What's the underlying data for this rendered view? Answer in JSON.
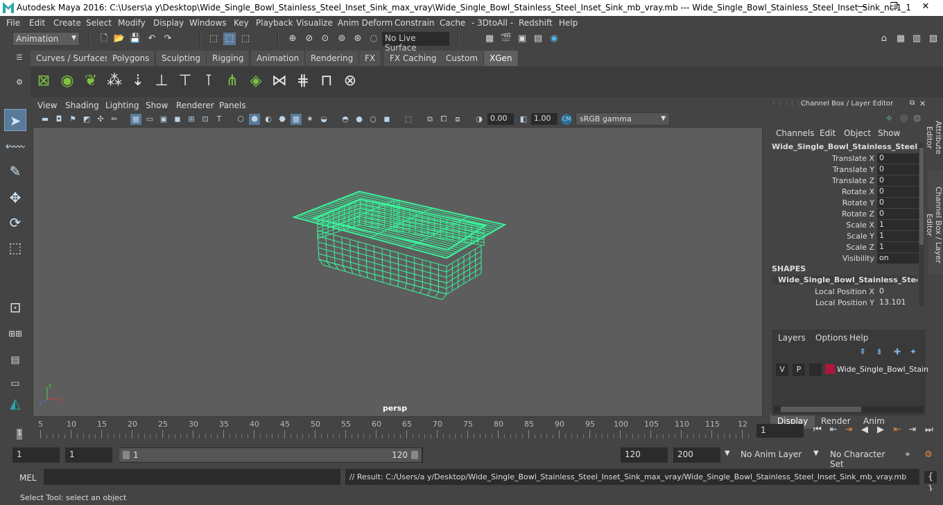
{
  "titlebar": {
    "title": "Autodesk Maya 2016: C:\\Users\\a y\\Desktop\\Wide_Single_Bowl_Stainless_Steel_Inset_Sink_max_vray\\Wide_Single_Bowl_Stainless_Steel_Inset_Sink_mb_vray.mb  ---  Wide_Single_Bowl_Stainless_Steel_Inset_Sink_ncl1_1",
    "minimize": "—",
    "maximize": "❐",
    "close": "✕"
  },
  "menubar": [
    "File",
    "Edit",
    "Create",
    "Select",
    "Modify",
    "Display",
    "Windows",
    "Key",
    "Playback",
    "Visualize",
    "Anim Deform",
    "Constrain",
    "Cache",
    "- 3DtoAll -",
    "Redshift",
    "Help"
  ],
  "statusline": {
    "mode": "Animation",
    "live_surface": "No Live Surface"
  },
  "shelf": {
    "tabs": [
      "Curves / Surfaces",
      "Polygons",
      "Sculpting",
      "Rigging",
      "Animation",
      "Rendering",
      "FX",
      "FX Caching",
      "Custom",
      "XGen"
    ],
    "active_tab": "XGen"
  },
  "viewport": {
    "menus": [
      "View",
      "Shading",
      "Lighting",
      "Show",
      "Renderer",
      "Panels"
    ],
    "exposure": "0.00",
    "gamma": "1.00",
    "color_space": "sRGB gamma",
    "camera_label": "persp",
    "wire_color": "#38f59a",
    "background": "#5d5d5d"
  },
  "channelbox": {
    "title": "Channel Box / Layer Editor",
    "menus": [
      "Channels",
      "Edit",
      "Object",
      "Show"
    ],
    "object_name": "Wide_Single_Bowl_Stainless_Steel_Ins...",
    "attributes": [
      {
        "label": "Translate X",
        "value": "0"
      },
      {
        "label": "Translate Y",
        "value": "0"
      },
      {
        "label": "Translate Z",
        "value": "0"
      },
      {
        "label": "Rotate X",
        "value": "0"
      },
      {
        "label": "Rotate Y",
        "value": "0"
      },
      {
        "label": "Rotate Z",
        "value": "0"
      },
      {
        "label": "Scale X",
        "value": "1"
      },
      {
        "label": "Scale Y",
        "value": "1"
      },
      {
        "label": "Scale Z",
        "value": "1"
      },
      {
        "label": "Visibility",
        "value": "on"
      }
    ],
    "shapes_header": "SHAPES",
    "shape_name": "Wide_Single_Bowl_Stainless_Steel_I...",
    "shape_attributes": [
      {
        "label": "Local Position X",
        "value": "0"
      },
      {
        "label": "Local Position Y",
        "value": "13.101"
      }
    ]
  },
  "side_tabs": {
    "attribute_editor": "Attribute Editor",
    "channel_box": "Channel Box / Layer Editor"
  },
  "layer_editor": {
    "tabs": [
      "Display",
      "Render",
      "Anim"
    ],
    "active_tab": "Display",
    "menus": [
      "Layers",
      "Options",
      "Help"
    ],
    "layer": {
      "visible": "V",
      "playback": "P",
      "name": "Wide_Single_Bowl_Stain",
      "color": "#b0153c"
    }
  },
  "timeslider": {
    "ticks": [
      "5",
      "10",
      "15",
      "20",
      "25",
      "30",
      "35",
      "40",
      "45",
      "50",
      "55",
      "60",
      "65",
      "70",
      "75",
      "80",
      "85",
      "90",
      "95",
      "100",
      "105",
      "110",
      "115",
      "12"
    ],
    "current_frame_marker": "1",
    "current_frame": "1"
  },
  "range": {
    "start_field": "1",
    "playback_start": "1",
    "slider_start": "1",
    "slider_end": "120",
    "playback_end": "120",
    "end_field": "200",
    "anim_layer": "No Anim Layer",
    "character_set": "No Character Set"
  },
  "commandline": {
    "label": "MEL",
    "result": "// Result: C:/Users/a y/Desktop/Wide_Single_Bowl_Stainless_Steel_Inset_Sink_max_vray/Wide_Single_Bowl_Stainless_Steel_Inset_Sink_mb_vray.mb"
  },
  "helpline": "Select Tool: select an object"
}
